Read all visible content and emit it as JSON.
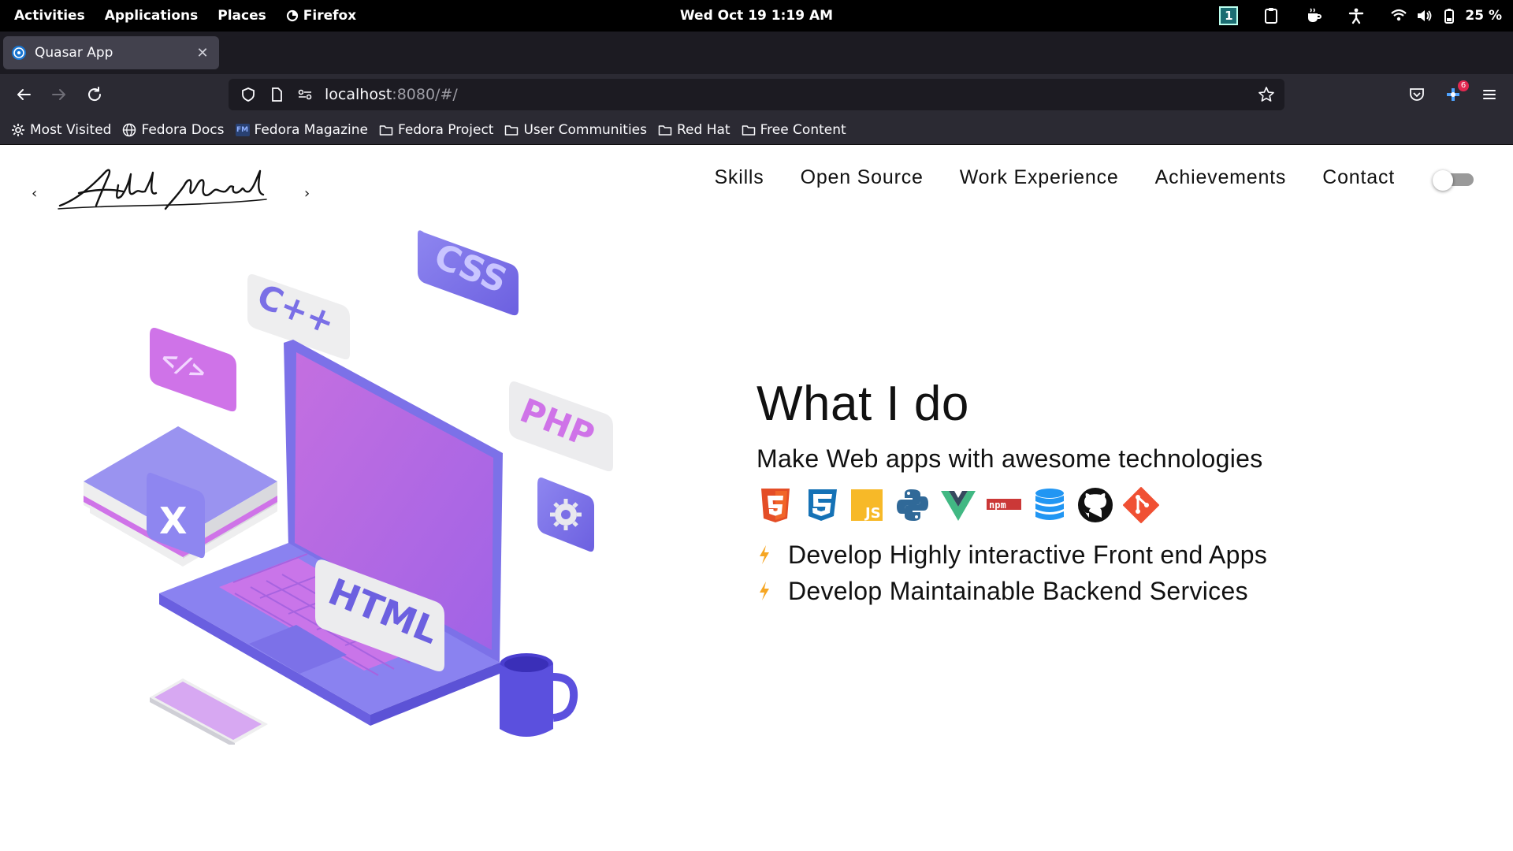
{
  "system_bar": {
    "activities": "Activities",
    "applications": "Applications",
    "places": "Places",
    "app_name": "Firefox",
    "datetime": "Wed Oct 19  1:19 AM",
    "workspace": "1",
    "battery": "25 %"
  },
  "browser": {
    "tab_title": "Quasar App",
    "url_host": "localhost",
    "url_path": ":8080/#/",
    "extension_badge": "6",
    "bookmarks": [
      "Most Visited",
      "Fedora Docs",
      "Fedora Magazine",
      "Fedora Project",
      "User Communities",
      "Red Hat",
      "Free Content"
    ]
  },
  "site": {
    "logo_text": "Abdul Mueed",
    "nav": [
      "Skills",
      "Open Source",
      "Work Experience",
      "Achievements",
      "Contact"
    ],
    "dark_mode_on": false,
    "illustration_labels": [
      "CSS",
      "C++",
      "</>",
      "PHP",
      "HTML",
      "X"
    ],
    "heading": "What I do",
    "subheading": "Make Web apps with awesome technologies",
    "tech_icons": [
      "html5-icon",
      "css3-icon",
      "javascript-icon",
      "python-icon",
      "vue-icon",
      "npm-icon",
      "database-icon",
      "github-icon",
      "git-icon"
    ],
    "bullets": [
      "Develop Highly interactive Front end Apps",
      "Develop Maintainable Backend Services"
    ],
    "colors": {
      "accent_bolt": "#f6a623",
      "illustration_purple": "#7b6ee8",
      "illustration_pink": "#d27be6"
    }
  }
}
